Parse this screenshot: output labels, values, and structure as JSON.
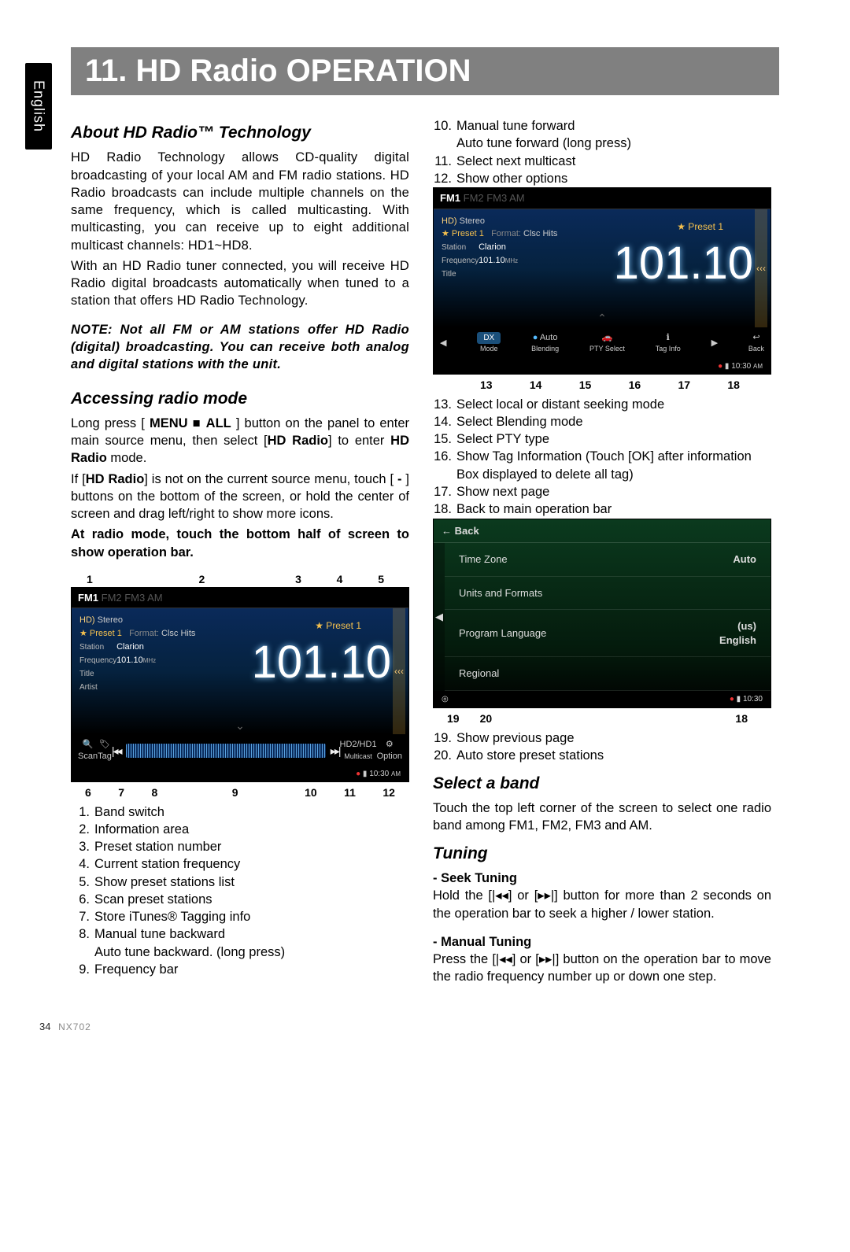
{
  "language_tab": "English",
  "page_title": "11. HD Radio OPERATION",
  "footer_page": "34",
  "footer_model": "NX702",
  "left": {
    "h_about": "About HD Radio™ Technology",
    "p_about_1": "HD Radio Technology allows CD-quality digital broadcasting of your local AM and FM radio stations. HD Radio broadcasts can include multiple channels on the same frequency, which is called multicasting. With multicasting, you can receive up to eight additional multicast channels: HD1~HD8.",
    "p_about_2": "With an HD Radio tuner connected, you will receive HD Radio digital broadcasts automatically when tuned to a station that offers HD Radio Technology.",
    "note": "NOTE: Not all FM or AM stations offer HD Radio (digital) broadcasting. You can receive both analog and digital stations with the unit.",
    "h_access": "Accessing radio mode",
    "p_access_1a": "Long press [ ",
    "p_access_menuall": "MENU ■ ALL",
    "p_access_1b": " ] button on the panel to enter main source menu, then select [",
    "p_access_hdradio": "HD Radio",
    "p_access_1c": "] to enter ",
    "p_access_hdradio2": "HD Radio",
    "p_access_1d": " mode.",
    "p_access_2a": "If [",
    "p_access_2b": "] is not on the current source menu, touch [ ",
    "p_access_dash": "-",
    "p_access_2c": " ] buttons on the bottom of the screen, or hold the center of screen and drag left/right to show more icons.",
    "p_access_bold": "At radio mode, touch the bottom half of screen to show operation bar.",
    "callouts_top": [
      "1",
      "2",
      "3",
      "4",
      "5"
    ],
    "callouts_bottom": [
      "6",
      "7",
      "8",
      "9",
      "10",
      "11",
      "12"
    ],
    "list1": [
      "Band switch",
      "Information area",
      "Preset station number",
      "Current station frequency",
      "Show preset stations list",
      "Scan preset stations",
      "Store iTunes® Tagging info",
      "Manual tune backward\nAuto tune backward. (long press)",
      "Frequency bar"
    ]
  },
  "right": {
    "list2_start": 10,
    "list2": [
      "Manual tune forward\nAuto tune forward (long press)",
      "Select next multicast",
      "Show other options"
    ],
    "callouts_mid": [
      "13",
      "14",
      "15",
      "16",
      "17",
      "18"
    ],
    "list3_start": 13,
    "list3": [
      "Select local or distant seeking mode",
      "Select Blending mode",
      "Select PTY type",
      "Show Tag Information (Touch [OK] after information Box displayed to delete all tag)",
      "Show next page",
      "Back to main operation bar"
    ],
    "callouts_low_left": [
      "19",
      "20"
    ],
    "callouts_low_right": "18",
    "list4_start": 19,
    "list4": [
      "Show previous page",
      "Auto store preset stations"
    ],
    "h_select": "Select a band",
    "p_select": "Touch the top left corner of the screen to select one radio band among FM1, FM2, FM3 and AM.",
    "h_tuning": "Tuning",
    "seek_head": "- Seek Tuning",
    "seek_body_a": "Hold the [",
    "seek_prev": "◂◂",
    "seek_body_b": "] or [",
    "seek_next": "▸▸",
    "seek_body_c": "] button for more than 2 seconds on the operation bar to seek a higher / lower station.",
    "man_head": "- Manual Tuning",
    "man_body_a": "Press the [",
    "man_body_b": "] or [",
    "man_body_c": "] button on the operation bar to move the radio frequency number up or down one step."
  },
  "screen": {
    "band_active": "FM1",
    "band_dim": "FM2 FM3 AM",
    "hd": "HD)",
    "stereo": "Stereo",
    "preset_star": "★ Preset 1",
    "format": "Format:",
    "format_val": "Clsc Hits",
    "station_lbl": "Station",
    "station": "Clarion",
    "freq_lbl": "Frequency",
    "freq_small": "101.10",
    "mhz": "MHz",
    "title_lbl": "Title",
    "artist_lbl": "Artist",
    "big_freq": "101.10",
    "preset_top": "★ Preset 1",
    "scan": "Scan",
    "tag": "Tag",
    "hd2": "HD2/HD1",
    "multicast": "Multicast",
    "option": "Option",
    "clock": "10:30",
    "ampm": "AM",
    "dx": "DX",
    "mode": "Mode",
    "auto": "Auto",
    "blending": "Blending",
    "pty": "PTY Select",
    "taginfo": "Tag Info",
    "back_icon": "↩",
    "back": "Back"
  },
  "settings": {
    "back": "← Back",
    "rows": [
      {
        "label": "Time Zone",
        "value": "Auto"
      },
      {
        "label": "Units and Formats",
        "value": ""
      },
      {
        "label": "Program Language",
        "value": "(us)\nEnglish"
      },
      {
        "label": "Regional",
        "value": ""
      }
    ]
  }
}
